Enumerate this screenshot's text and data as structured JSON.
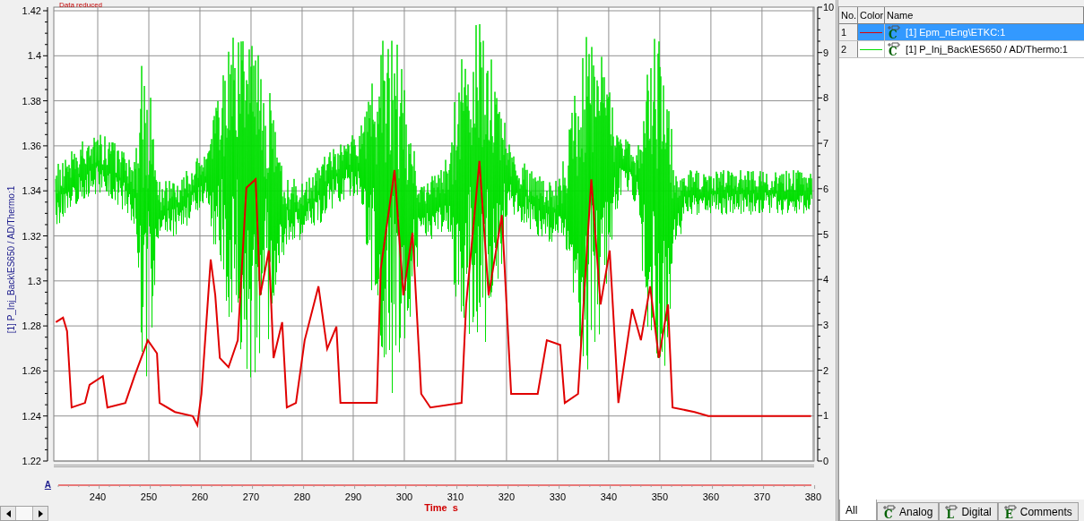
{
  "plot": {
    "notice": "Data reduced",
    "y_axis_label": "[1] P_Inj_Back\\ES650 / AD/Thermo:1",
    "left_ticks": [
      "1.42",
      "1.4",
      "1.38",
      "1.36",
      "1.34",
      "1.32",
      "1.3",
      "1.28",
      "1.26",
      "1.24",
      "1.22"
    ],
    "right_ticks": [
      "10",
      "9",
      "8",
      "7",
      "6",
      "5",
      "4",
      "3",
      "2",
      "1",
      "0"
    ],
    "x_ticks": [
      "240",
      "250",
      "260",
      "270",
      "280",
      "290",
      "300",
      "310",
      "320",
      "330",
      "340",
      "350",
      "360",
      "370",
      "380"
    ],
    "x_axis_label": "Time  s",
    "axis_link": "A"
  },
  "signals_table": {
    "columns": [
      "No.",
      "Color",
      "Name"
    ],
    "rows": [
      {
        "no": "1",
        "color": "#e00000",
        "icon_letter": "C",
        "name": "[1]  Epm_nEng\\ETKC:1",
        "selected": true
      },
      {
        "no": "2",
        "color": "#00e000",
        "icon_letter": "C",
        "name": "[1]  P_Inj_Back\\ES650 / AD/Thermo:1",
        "selected": false
      }
    ]
  },
  "tabs": [
    {
      "label": "All",
      "selected": true
    },
    {
      "label": "Analog",
      "icon_letter": "C",
      "selected": false
    },
    {
      "label": "Digital",
      "icon_letter": "L",
      "selected": false
    },
    {
      "label": "Comments",
      "icon_letter": "E",
      "selected": false
    }
  ]
}
